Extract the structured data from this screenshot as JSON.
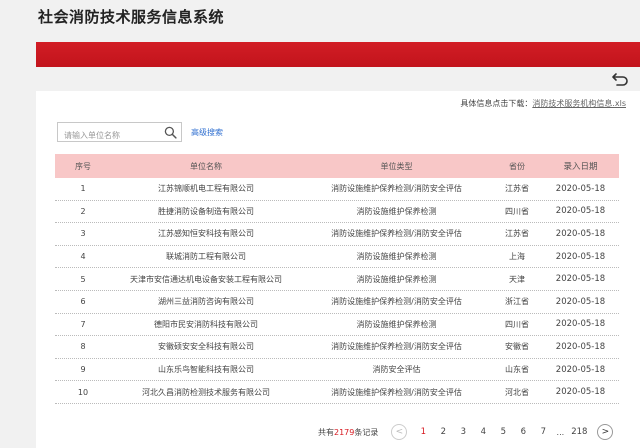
{
  "header": {
    "title": "社会消防技术服务信息系统"
  },
  "panel": {
    "download_prefix": "具体信息点击下载：",
    "download_link": "消防技术服务机构信息.xls"
  },
  "search": {
    "placeholder": "请输入单位名称",
    "advanced_label": "高级搜索"
  },
  "table": {
    "headers": {
      "no": "序号",
      "name": "单位名称",
      "type": "单位类型",
      "province": "省份",
      "date": "录入日期"
    },
    "rows": [
      {
        "no": "1",
        "name": "江苏锦顺机电工程有限公司",
        "type": "消防设施维护保养检测/消防安全评估",
        "province": "江苏省",
        "date": "2020-05-18"
      },
      {
        "no": "2",
        "name": "胜捷消防设备制造有限公司",
        "type": "消防设施维护保养检测",
        "province": "四川省",
        "date": "2020-05-18"
      },
      {
        "no": "3",
        "name": "江苏感知恒安科技有限公司",
        "type": "消防设施维护保养检测/消防安全评估",
        "province": "江苏省",
        "date": "2020-05-18"
      },
      {
        "no": "4",
        "name": "联城消防工程有限公司",
        "type": "消防设施维护保养检测",
        "province": "上海",
        "date": "2020-05-18"
      },
      {
        "no": "5",
        "name": "天津市安信通达机电设备安装工程有限公司",
        "type": "消防设施维护保养检测",
        "province": "天津",
        "date": "2020-05-18"
      },
      {
        "no": "6",
        "name": "湖州三益消防咨询有限公司",
        "type": "消防设施维护保养检测/消防安全评估",
        "province": "浙江省",
        "date": "2020-05-18"
      },
      {
        "no": "7",
        "name": "德阳市民安消防科技有限公司",
        "type": "消防设施维护保养检测",
        "province": "四川省",
        "date": "2020-05-18"
      },
      {
        "no": "8",
        "name": "安徽硕安安全科技有限公司",
        "type": "消防设施维护保养检测/消防安全评估",
        "province": "安徽省",
        "date": "2020-05-18"
      },
      {
        "no": "9",
        "name": "山东乐鸟智能科技有限公司",
        "type": "消防安全评估",
        "province": "山东省",
        "date": "2020-05-18"
      },
      {
        "no": "10",
        "name": "河北久昌消防检测技术服务有限公司",
        "type": "消防设施维护保养检测/消防安全评估",
        "province": "河北省",
        "date": "2020-05-18"
      }
    ]
  },
  "pagination": {
    "total_prefix": "共有",
    "total_count": "2179",
    "total_suffix": "条记录",
    "prev_symbol": "<",
    "next_symbol": ">",
    "pages": [
      "1",
      "2",
      "3",
      "4",
      "5",
      "6",
      "7"
    ],
    "ellipsis": "...",
    "last_page": "218",
    "current_page": "1"
  },
  "colors": {
    "brand_red": "#c8161e",
    "table_header_bg": "#f8c7c7",
    "link_blue": "#2f6fd0",
    "active_page": "#d71920"
  },
  "icons": {
    "back": "return-arrow-icon",
    "search": "magnifier-icon"
  }
}
